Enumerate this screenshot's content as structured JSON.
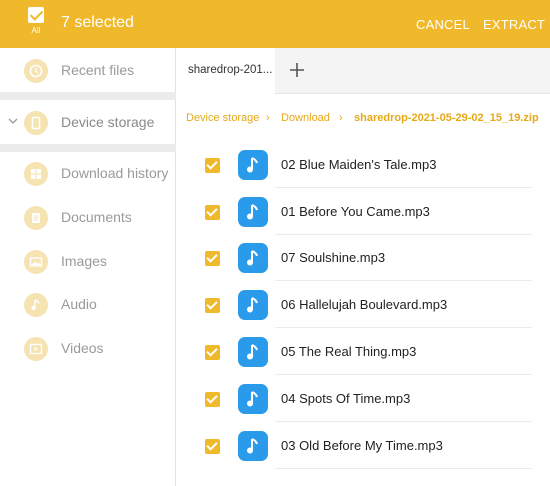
{
  "header": {
    "all_label": "All",
    "selected_text": "7 selected",
    "cancel_label": "CANCEL",
    "extract_label": "EXTRACT",
    "accent_color": "#f0b92b"
  },
  "sidebar": {
    "items": [
      {
        "label": "Recent files",
        "icon": "clock-icon"
      },
      {
        "label": "Device storage",
        "icon": "phone-icon"
      },
      {
        "label": "Download history",
        "icon": "download-history-icon"
      },
      {
        "label": "Documents",
        "icon": "document-icon"
      },
      {
        "label": "Images",
        "icon": "image-icon"
      },
      {
        "label": "Audio",
        "icon": "music-icon"
      },
      {
        "label": "Videos",
        "icon": "video-icon"
      }
    ]
  },
  "tabs": [
    {
      "label": "sharedrop-201..."
    }
  ],
  "breadcrumb": {
    "items": [
      "Device storage",
      "Download",
      "sharedrop-2021-05-29-02_15_19.zip"
    ]
  },
  "files": [
    {
      "name": "02 Blue Maiden's Tale.mp3",
      "checked": true
    },
    {
      "name": "01 Before You Came.mp3",
      "checked": true
    },
    {
      "name": "07 Soulshine.mp3",
      "checked": true
    },
    {
      "name": "06 Hallelujah Boulevard.mp3",
      "checked": true
    },
    {
      "name": "05 The Real Thing.mp3",
      "checked": true
    },
    {
      "name": "04 Spots Of Time.mp3",
      "checked": true
    },
    {
      "name": "03 Old Before My Time.mp3",
      "checked": true
    }
  ]
}
